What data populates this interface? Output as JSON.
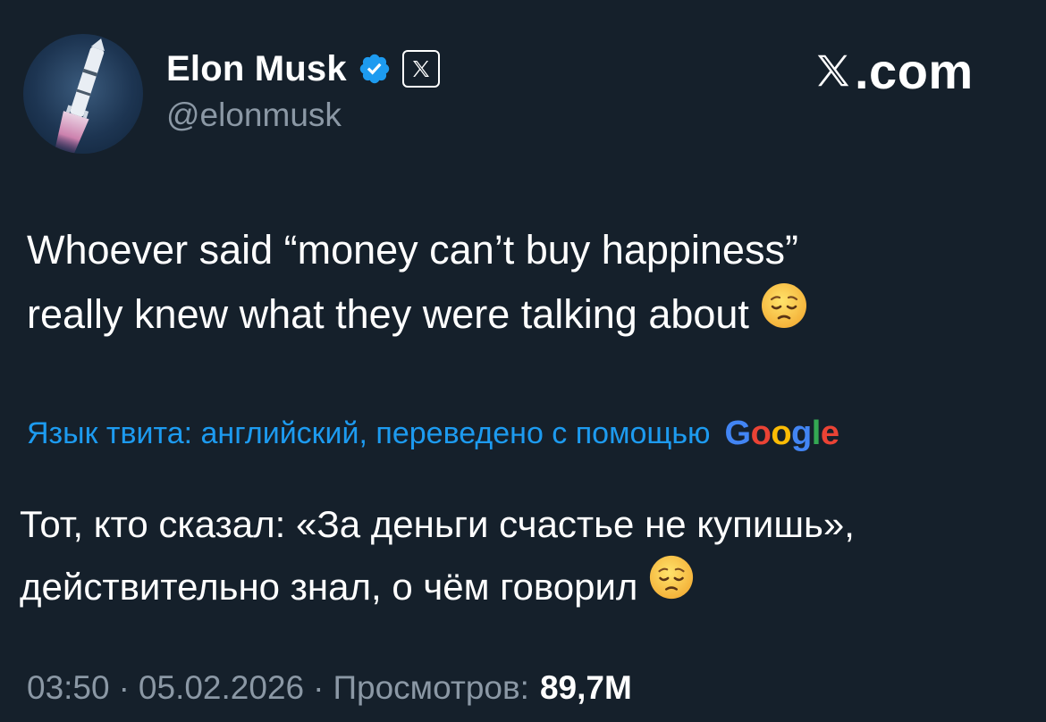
{
  "author": {
    "name": "Elon Musk",
    "handle": "@elonmusk"
  },
  "icons": {
    "verified": "verified-badge-icon",
    "x_affiliation": "x-logo-icon",
    "site_logo": "x-logo-icon",
    "emoji": "pensive-face-emoji",
    "avatar": "rocket-avatar"
  },
  "colors": {
    "background": "#15202b",
    "verified": "#1d9bf0",
    "link": "#1d9bf0",
    "muted": "#8b98a5"
  },
  "site": {
    "label": ".com"
  },
  "tweet": {
    "line1": "Whoever said “money can’t buy happiness”",
    "line2": "really knew what they were talking about"
  },
  "translation": {
    "note": "Язык твита: английский, переведено с помощью",
    "provider_letters": [
      "G",
      "o",
      "o",
      "g",
      "l",
      "e"
    ],
    "line1": "Тот, кто сказал: «За деньги счастье не купишь»,",
    "line2": "действительно знал, о чём говорил"
  },
  "meta": {
    "time": "03:50",
    "date": "05.02.2026",
    "views_label": "Просмотров:",
    "views_count": "89,7M",
    "separator": "·"
  }
}
